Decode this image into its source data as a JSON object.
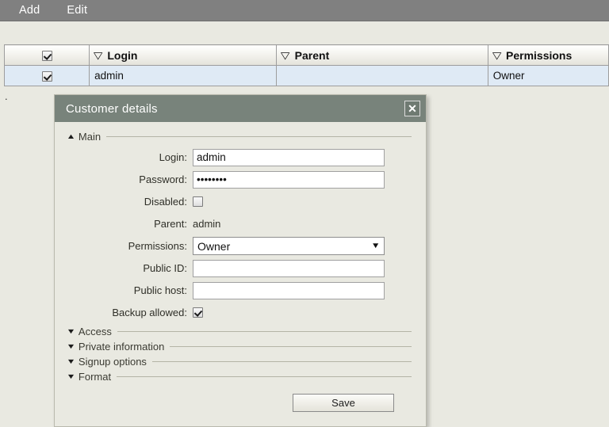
{
  "menubar": {
    "items": [
      {
        "label": "Add",
        "name": "menu-add"
      },
      {
        "label": "Edit",
        "name": "menu-edit"
      }
    ]
  },
  "grid": {
    "columns": [
      {
        "label": "",
        "sort_icon": "▽"
      },
      {
        "label": "Login",
        "sort_icon": "▽"
      },
      {
        "label": "Parent",
        "sort_icon": "▽"
      },
      {
        "label": "Permissions",
        "sort_icon": "▽"
      }
    ],
    "header_checkbox_checked": true,
    "rows": [
      {
        "checked": true,
        "login": "admin",
        "parent": "",
        "permissions": "Owner"
      }
    ]
  },
  "stray_text": ".",
  "dialog": {
    "title": "Customer details",
    "close_label": "✕",
    "sections": [
      {
        "label": "Main",
        "expanded": true,
        "triangle": "▲"
      },
      {
        "label": "Access",
        "expanded": false,
        "triangle": "▼"
      },
      {
        "label": "Private information",
        "expanded": false,
        "triangle": "▼"
      },
      {
        "label": "Signup options",
        "expanded": false,
        "triangle": "▼"
      },
      {
        "label": "Format",
        "expanded": false,
        "triangle": "▼"
      }
    ],
    "fields": {
      "login_label": "Login:",
      "login_value": "admin",
      "login_placeholder": "",
      "password_label": "Password:",
      "password_value": "password",
      "password_placeholder": "",
      "disabled_label": "Disabled:",
      "disabled_checked": false,
      "parent_label": "Parent:",
      "parent_value": "admin",
      "permissions_label": "Permissions:",
      "permissions_value": "Owner",
      "permissions_options": [
        "Owner"
      ],
      "permissions_arrow": "▼",
      "public_id_label": "Public ID:",
      "public_id_value": "",
      "public_id_placeholder": "",
      "public_host_label": "Public host:",
      "public_host_value": "",
      "public_host_placeholder": "",
      "backup_allowed_label": "Backup allowed:",
      "backup_allowed_checked": true
    },
    "save_label": "Save"
  },
  "colors": {
    "menubar_bg": "#808080",
    "page_bg": "#e9e9e1",
    "dialog_titlebar": "#78837b",
    "row_selected_bg": "#dfeaf5",
    "grid_border": "#9d9d9d"
  }
}
